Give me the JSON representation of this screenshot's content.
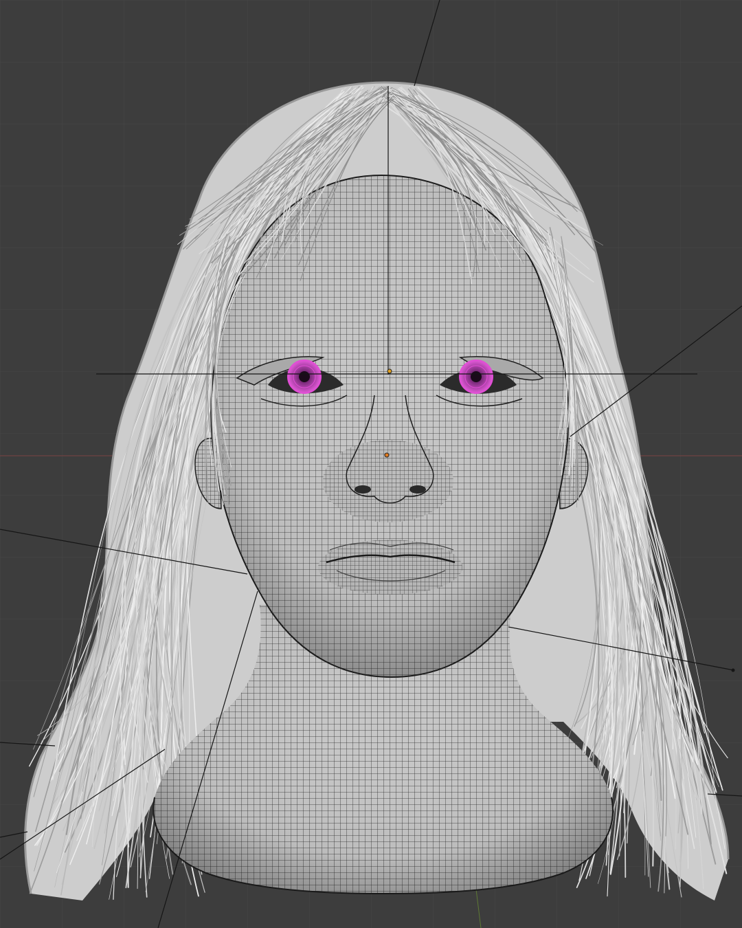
{
  "viewport": {
    "background_color": "#3d3d3d",
    "grid_color": "#464646",
    "mesh_color": "#c9c9c9",
    "wire_color": "#1e1e1e",
    "hair_color": "#cfcfcf",
    "x_axis_color": "#8a4a4a",
    "y_axis_color": "#6a8a3a",
    "iris_color": "#d84fd0",
    "origin_color": "#e08a1e"
  },
  "scene": {
    "object": "head-sculpt-wireframe",
    "shading": "solid",
    "overlay": "wireframe"
  }
}
